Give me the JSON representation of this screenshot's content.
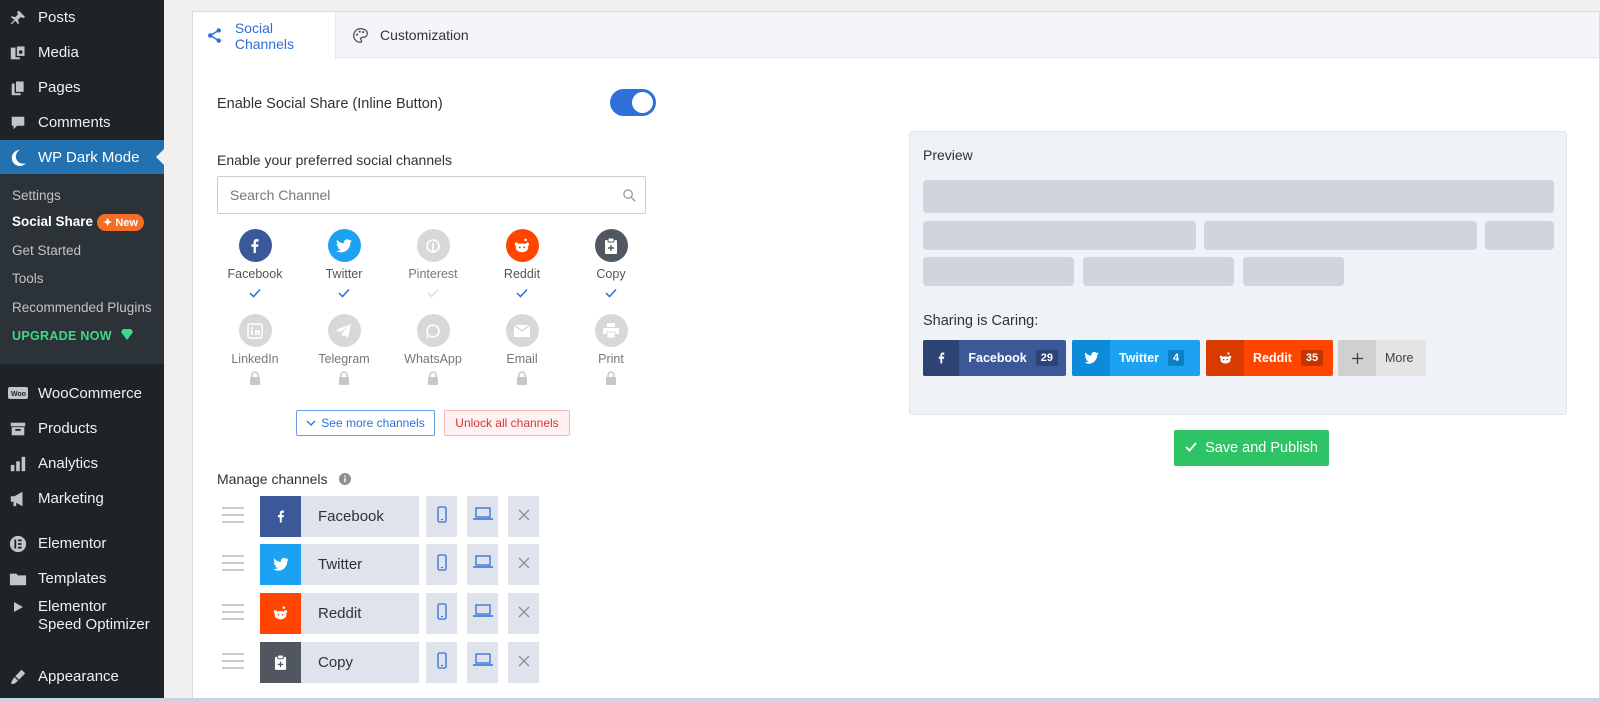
{
  "sidebar": {
    "items": [
      {
        "label": "Posts",
        "icon": "pin-icon"
      },
      {
        "label": "Media",
        "icon": "media-icon"
      },
      {
        "label": "Pages",
        "icon": "pages-icon"
      },
      {
        "label": "Comments",
        "icon": "comment-icon"
      },
      {
        "label": "WP Dark Mode",
        "icon": "moon-icon"
      },
      {
        "label": "WooCommerce",
        "icon": "woo-icon"
      },
      {
        "label": "Products",
        "icon": "archive-icon"
      },
      {
        "label": "Analytics",
        "icon": "bar-chart-icon"
      },
      {
        "label": "Marketing",
        "icon": "megaphone-icon"
      },
      {
        "label": "Elementor",
        "icon": "elementor-icon"
      },
      {
        "label": "Templates",
        "icon": "folder-icon"
      },
      {
        "label": "Elementor Speed Optimizer",
        "icon": "play-icon"
      },
      {
        "label": "Appearance",
        "icon": "brush-icon"
      }
    ],
    "submenu": {
      "settings": "Settings",
      "social_share": "Social Share",
      "new_badge": "New",
      "get_started": "Get Started",
      "tools": "Tools",
      "recommended_plugins": "Recommended Plugins",
      "upgrade": "UPGRADE NOW"
    }
  },
  "tabs": [
    {
      "label": "Social Channels",
      "icon": "share-icon",
      "active": true
    },
    {
      "label": "Customization",
      "icon": "palette-icon",
      "active": false
    }
  ],
  "settings": {
    "enable_label": "Enable Social Share (Inline Button)",
    "enabled": true,
    "channels_label": "Enable your preferred social channels",
    "search_placeholder": "Search Channel",
    "see_more": "See more channels",
    "unlock": "Unlock all channels",
    "manage_label": "Manage channels"
  },
  "channels": [
    {
      "name": "Facebook",
      "color": "#3b5998",
      "enabled": true,
      "locked": false
    },
    {
      "name": "Twitter",
      "color": "#1da1f2",
      "enabled": true,
      "locked": false
    },
    {
      "name": "Pinterest",
      "color": "#d8d8d8",
      "enabled": false,
      "locked": false
    },
    {
      "name": "Reddit",
      "color": "#ff4500",
      "enabled": true,
      "locked": false
    },
    {
      "name": "Copy",
      "color": "#50575e",
      "enabled": true,
      "locked": false
    },
    {
      "name": "LinkedIn",
      "color": "#d8d8d8",
      "enabled": false,
      "locked": true
    },
    {
      "name": "Telegram",
      "color": "#d8d8d8",
      "enabled": false,
      "locked": true
    },
    {
      "name": "WhatsApp",
      "color": "#d8d8d8",
      "enabled": false,
      "locked": true
    },
    {
      "name": "Email",
      "color": "#d8d8d8",
      "enabled": false,
      "locked": true
    },
    {
      "name": "Print",
      "color": "#d8d8d8",
      "enabled": false,
      "locked": true
    }
  ],
  "manage": [
    {
      "name": "Facebook",
      "color": "#3b5998"
    },
    {
      "name": "Twitter",
      "color": "#1da1f2"
    },
    {
      "name": "Reddit",
      "color": "#ff4500"
    },
    {
      "name": "Copy",
      "color": "#50575e"
    }
  ],
  "preview": {
    "title": "Preview",
    "sharing_label": "Sharing is Caring:",
    "buttons": [
      {
        "label": "Facebook",
        "count": "29",
        "color": "#3b5998"
      },
      {
        "label": "Twitter",
        "count": "4",
        "color": "#1da1f2"
      },
      {
        "label": "Reddit",
        "count": "35",
        "color": "#ff4500"
      }
    ],
    "more_label": "More"
  },
  "save_label": "Save and Publish"
}
